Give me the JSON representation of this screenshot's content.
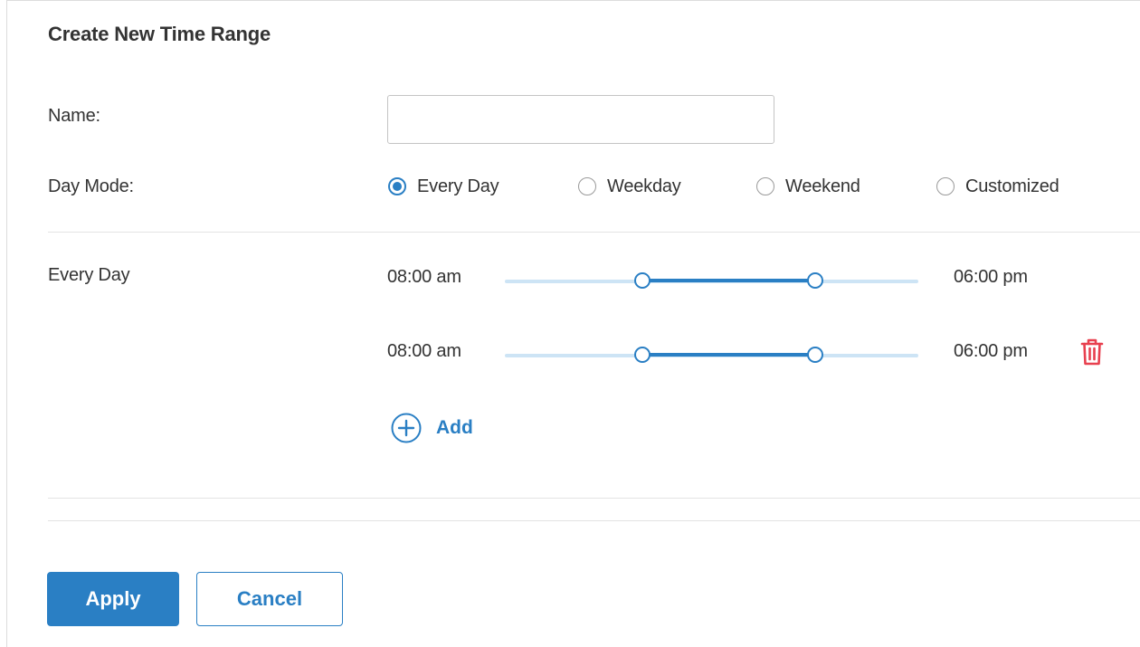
{
  "form": {
    "title": "Create New Time Range",
    "name_label": "Name:",
    "name_value": "",
    "name_placeholder": "",
    "day_mode_label": "Day Mode:",
    "day_mode_options": [
      {
        "label": "Every Day",
        "checked": true
      },
      {
        "label": "Weekday",
        "checked": false
      },
      {
        "label": "Weekend",
        "checked": false
      },
      {
        "label": "Customized",
        "checked": false
      }
    ]
  },
  "schedule": {
    "section_label": "Every Day",
    "ranges": [
      {
        "start": "08:00 am",
        "end": "06:00 pm",
        "start_fraction": 0.333,
        "end_fraction": 0.75,
        "deletable": false
      },
      {
        "start": "08:00 am",
        "end": "06:00 pm",
        "start_fraction": 0.333,
        "end_fraction": 0.75,
        "deletable": true
      }
    ],
    "add_label": "Add"
  },
  "actions": {
    "apply_label": "Apply",
    "cancel_label": "Cancel"
  },
  "colors": {
    "accent": "#2a7fc4",
    "track": "#cde4f5",
    "delete": "#e8404f"
  },
  "icons": {
    "add": "plus-circle-icon",
    "delete": "trash-icon"
  }
}
